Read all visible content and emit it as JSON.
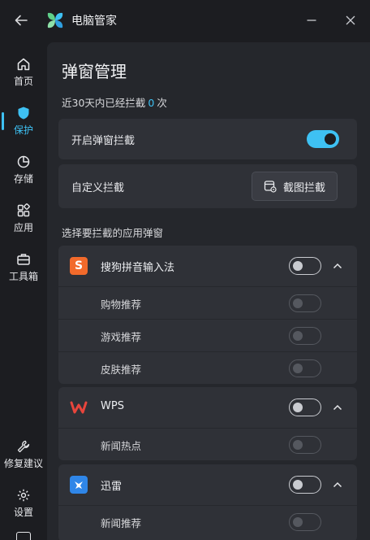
{
  "titlebar": {
    "title": "电脑管家"
  },
  "sidebar": {
    "items": [
      {
        "label": "首页"
      },
      {
        "label": "保护"
      },
      {
        "label": "存储"
      },
      {
        "label": "应用"
      },
      {
        "label": "工具箱"
      }
    ],
    "bottom_items": [
      {
        "label": "修复建议"
      },
      {
        "label": "设置"
      }
    ],
    "active_index": 1
  },
  "main": {
    "title": "弹窗管理",
    "stat": {
      "prefix": "近30天内已经拦截",
      "count": "0",
      "suffix": "次"
    },
    "popup_block": {
      "label": "开启弹窗拦截",
      "enabled": true
    },
    "custom_block": {
      "label": "自定义拦截",
      "button_label": "截图拦截"
    },
    "section_title": "选择要拦截的应用弹窗",
    "apps": [
      {
        "name": "搜狗拼音输入法",
        "icon": "sogou-icon",
        "enabled": false,
        "sub_items": [
          {
            "label": "购物推荐",
            "enabled": false
          },
          {
            "label": "游戏推荐",
            "enabled": false
          },
          {
            "label": "皮肤推荐",
            "enabled": false
          }
        ]
      },
      {
        "name": "WPS",
        "icon": "wps-icon",
        "enabled": false,
        "sub_items": [
          {
            "label": "新闻热点",
            "enabled": false
          }
        ]
      },
      {
        "name": "迅雷",
        "icon": "xunlei-icon",
        "enabled": false,
        "sub_items": [
          {
            "label": "新闻推荐",
            "enabled": false
          }
        ]
      }
    ]
  },
  "colors": {
    "accent": "#3ec1f3",
    "background": "#1c1d21",
    "panel": "#25272c",
    "card": "#2f3137"
  }
}
